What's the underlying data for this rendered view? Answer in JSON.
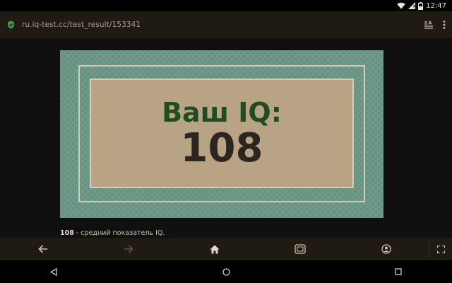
{
  "status_bar": {
    "time": "12:47"
  },
  "browser": {
    "url": "ru.iq-test.cc/test_result/153341",
    "icons": {
      "secure": "shield-check-icon",
      "reader": "reader-mode-icon",
      "menu": "more-vert-icon"
    }
  },
  "result": {
    "label": "Ваш IQ:",
    "value": "108",
    "description_value": "108",
    "description_text": " - средний показатель IQ."
  },
  "toolbar": {
    "icons": [
      "back-arrow-icon",
      "forward-arrow-icon",
      "home-icon",
      "tabs-icon",
      "account-icon",
      "fullscreen-icon"
    ]
  },
  "colors": {
    "accent": "#37a04a",
    "card_border": "#6a9786",
    "card_inner": "#b8a385",
    "label_green": "#1f4d21"
  }
}
